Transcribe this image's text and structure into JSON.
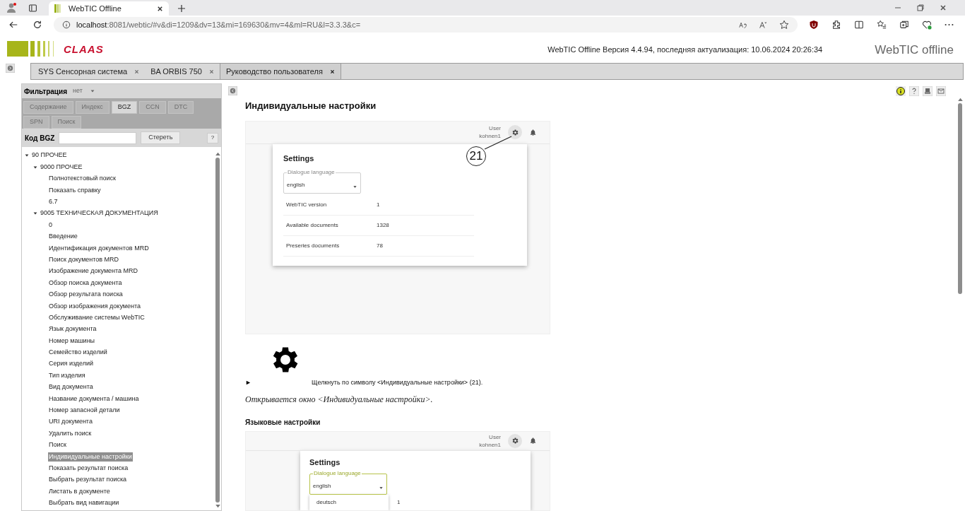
{
  "browser": {
    "tab_title": "WebTIC Offline",
    "url_host": "localhost",
    "url_rest": ":8081/webtic/#v&di=1209&dv=13&mi=169630&mv=4&ml=RU&l=3.3.3&c="
  },
  "app_header": {
    "logo_text": "CLAAS",
    "version_text": "WebTIC Offline Версия 4.4.94, последняя актуализация: 10.06.2024 20:26:34",
    "product_name": "WebTIC offline"
  },
  "doc_tabs": [
    {
      "label": "SYS Сенсорная система",
      "selected": false
    },
    {
      "label": "BA ORBIS 750",
      "selected": false
    },
    {
      "label": "Руководство пользователя",
      "selected": true
    }
  ],
  "sidebar": {
    "filter_label": "Фильтрация",
    "filter_value": "нет",
    "tabs": [
      {
        "label": "Содержание",
        "selected": false
      },
      {
        "label": "Индекс",
        "selected": false
      },
      {
        "label": "BGZ",
        "selected": true
      },
      {
        "label": "CCN",
        "selected": false
      },
      {
        "label": "DTC",
        "selected": false
      },
      {
        "label": "SPN",
        "selected": false
      },
      {
        "label": "Поиск",
        "selected": false
      }
    ],
    "code_label": "Код BGZ",
    "clear_button": "Стереть",
    "help_button": "?",
    "tree": [
      {
        "label": "90 ПРОЧЕЕ",
        "expanded": true,
        "children": [
          {
            "label": "9000 ПРОЧЕЕ",
            "expanded": true,
            "children": [
              {
                "label": "Полнотекстовый поиск",
                "selected": false
              },
              {
                "label": "Показать справку",
                "selected": false
              },
              {
                "label": "6.7",
                "selected": false
              }
            ]
          },
          {
            "label": "9005 ТЕХНИЧЕСКАЯ ДОКУМЕНТАЦИЯ",
            "expanded": true,
            "children": [
              {
                "label": "0",
                "selected": false
              },
              {
                "label": "Введение",
                "selected": false
              },
              {
                "label": "Идентификация документов MRD",
                "selected": false
              },
              {
                "label": "Поиск документов MRD",
                "selected": false
              },
              {
                "label": "Изображение документа MRD",
                "selected": false
              },
              {
                "label": "Обзор поиска документа",
                "selected": false
              },
              {
                "label": "Обзор результата поиска",
                "selected": false
              },
              {
                "label": "Обзор изображения документа",
                "selected": false
              },
              {
                "label": "Обслуживание системы WebTIC",
                "selected": false
              },
              {
                "label": "Язык документа",
                "selected": false
              },
              {
                "label": "Номер машины",
                "selected": false
              },
              {
                "label": "Семейство изделий",
                "selected": false
              },
              {
                "label": "Серия изделий",
                "selected": false
              },
              {
                "label": "Тип изделия",
                "selected": false
              },
              {
                "label": "Вид документа",
                "selected": false
              },
              {
                "label": "Название документа / машина",
                "selected": false
              },
              {
                "label": "Номер запасной детали",
                "selected": false
              },
              {
                "label": "URI документа",
                "selected": false
              },
              {
                "label": "Удалить поиск",
                "selected": false
              },
              {
                "label": "Поиск",
                "selected": false
              },
              {
                "label": "Индивидуальные настройки",
                "selected": true
              },
              {
                "label": "Показать результат поиска",
                "selected": false
              },
              {
                "label": "Выбрать результат поиска",
                "selected": false
              },
              {
                "label": "Листать в документе",
                "selected": false
              },
              {
                "label": "Выбрать вид навигации",
                "selected": false
              }
            ]
          }
        ]
      }
    ]
  },
  "content": {
    "title": "Индивидуальные настройки",
    "screenshot_1": {
      "user_label": "User",
      "user_name": "kohnen1",
      "callout": "21",
      "settings_title": "Settings",
      "field_label": "Dialogue language",
      "field_value": "english",
      "focused": false,
      "rows": [
        {
          "label": "WebTIC version",
          "value": "1"
        },
        {
          "label": "Available documents",
          "value": "1328"
        },
        {
          "label": "Preseries documents",
          "value": "78"
        }
      ]
    },
    "step_marker": "►",
    "step_text": "Щелкнуть по символу <Индивидуальные настройки> (21).",
    "result_text": "Открывается окно <Индивидуальные настройки>.",
    "section_heading": "Языковые настройки",
    "screenshot_2": {
      "user_label": "User",
      "user_name": "kohnen1",
      "settings_title": "Settings",
      "field_label": "Dialogue language",
      "field_value": "english",
      "focused": true,
      "option": "deutsch",
      "row_value": "1"
    }
  }
}
